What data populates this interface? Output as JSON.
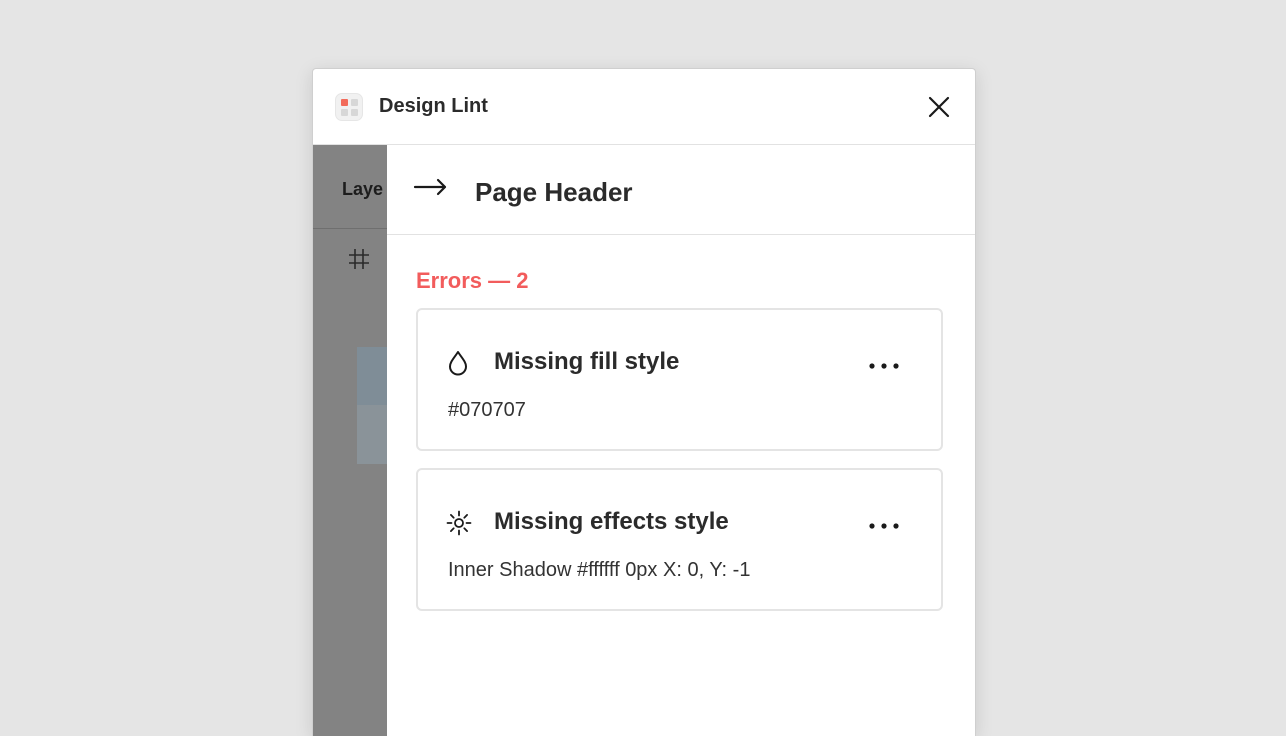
{
  "window": {
    "title": "Design Lint",
    "app_icon": "design-lint-logo",
    "close_icon": "close-icon"
  },
  "background_panel": {
    "tab_label": "Laye",
    "frame_icon": "frame-hash-icon"
  },
  "detail": {
    "back_icon": "arrow-right-icon",
    "layer_name": "Page Header",
    "errors_heading": "Errors — 2",
    "errors": [
      {
        "icon": "fill-drop-icon",
        "title": "Missing fill style",
        "value": "#070707",
        "menu_icon": "more-options-icon"
      },
      {
        "icon": "effects-sun-icon",
        "title": "Missing effects style",
        "value": "Inner Shadow #ffffff 0px X: 0, Y: -1",
        "menu_icon": "more-options-icon"
      }
    ]
  },
  "colors": {
    "error_accent": "#f25c5c",
    "backdrop": "#838383",
    "page_bg": "#e5e5e5"
  }
}
